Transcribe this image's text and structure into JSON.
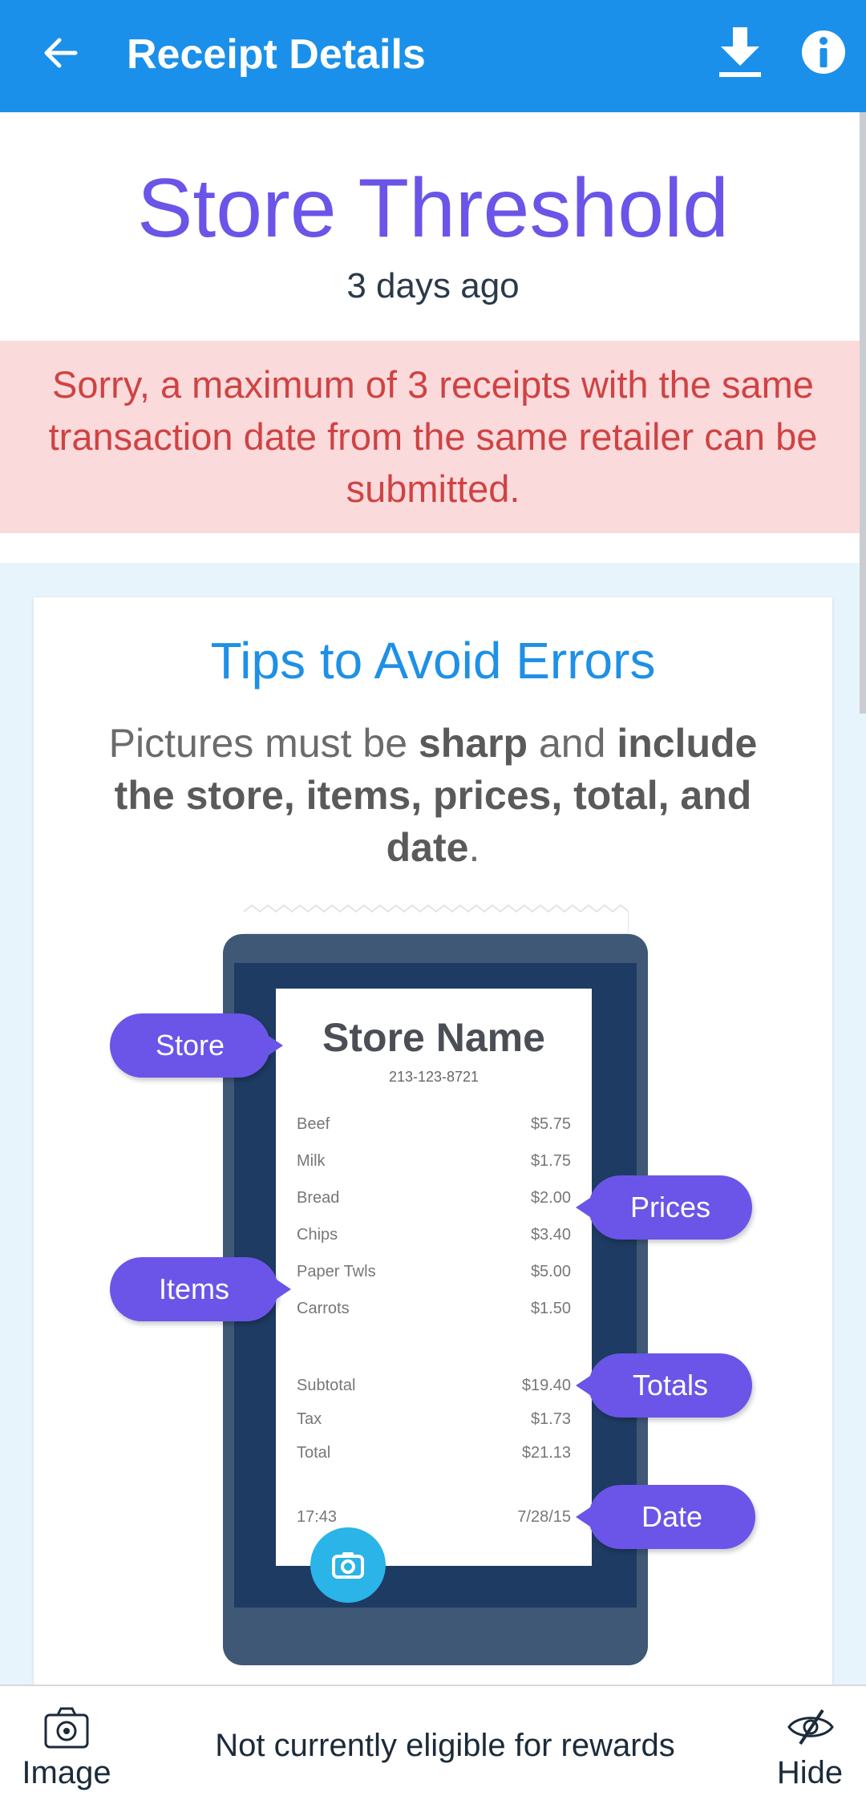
{
  "header": {
    "title": "Receipt Details",
    "colors": {
      "bar": "#1a90ea"
    },
    "icons": [
      "back-arrow-icon",
      "download-icon",
      "info-icon"
    ]
  },
  "summary": {
    "store_title": "Store Threshold",
    "time_ago": "3 days ago",
    "error_message": "Sorry, a maximum of 3 receipts with the same transaction date from the same retailer can be submitted."
  },
  "tips": {
    "title": "Tips to Avoid Errors",
    "text_1": "Pictures must be ",
    "text_sharp": "sharp",
    "text_2": " and ",
    "text_include": "include the store, items, prices, total, and date",
    "text_3": "."
  },
  "receipt": {
    "store_name": "Store Name",
    "phone": "213-123-8721",
    "items": [
      {
        "label": "Beef",
        "price": "$5.75"
      },
      {
        "label": "Milk",
        "price": "$1.75"
      },
      {
        "label": "Bread",
        "price": "$2.00"
      },
      {
        "label": "Chips",
        "price": "$3.40"
      },
      {
        "label": "Paper Twls",
        "price": "$5.00"
      },
      {
        "label": "Carrots",
        "price": "$1.50"
      }
    ],
    "subtotal_label": "Subtotal",
    "subtotal": "$19.40",
    "tax_label": "Tax",
    "tax": "$1.73",
    "total_label": "Total",
    "total": "$21.13",
    "time": "17:43",
    "date": "7/28/15"
  },
  "callouts": {
    "store": "Store",
    "items": "Items",
    "prices": "Prices",
    "totals": "Totals",
    "date": "Date"
  },
  "bottom": {
    "image_label": "Image",
    "status": "Not currently eligible for rewards",
    "hide_label": "Hide",
    "icons": [
      "camera-icon",
      "eye-off-icon"
    ]
  }
}
